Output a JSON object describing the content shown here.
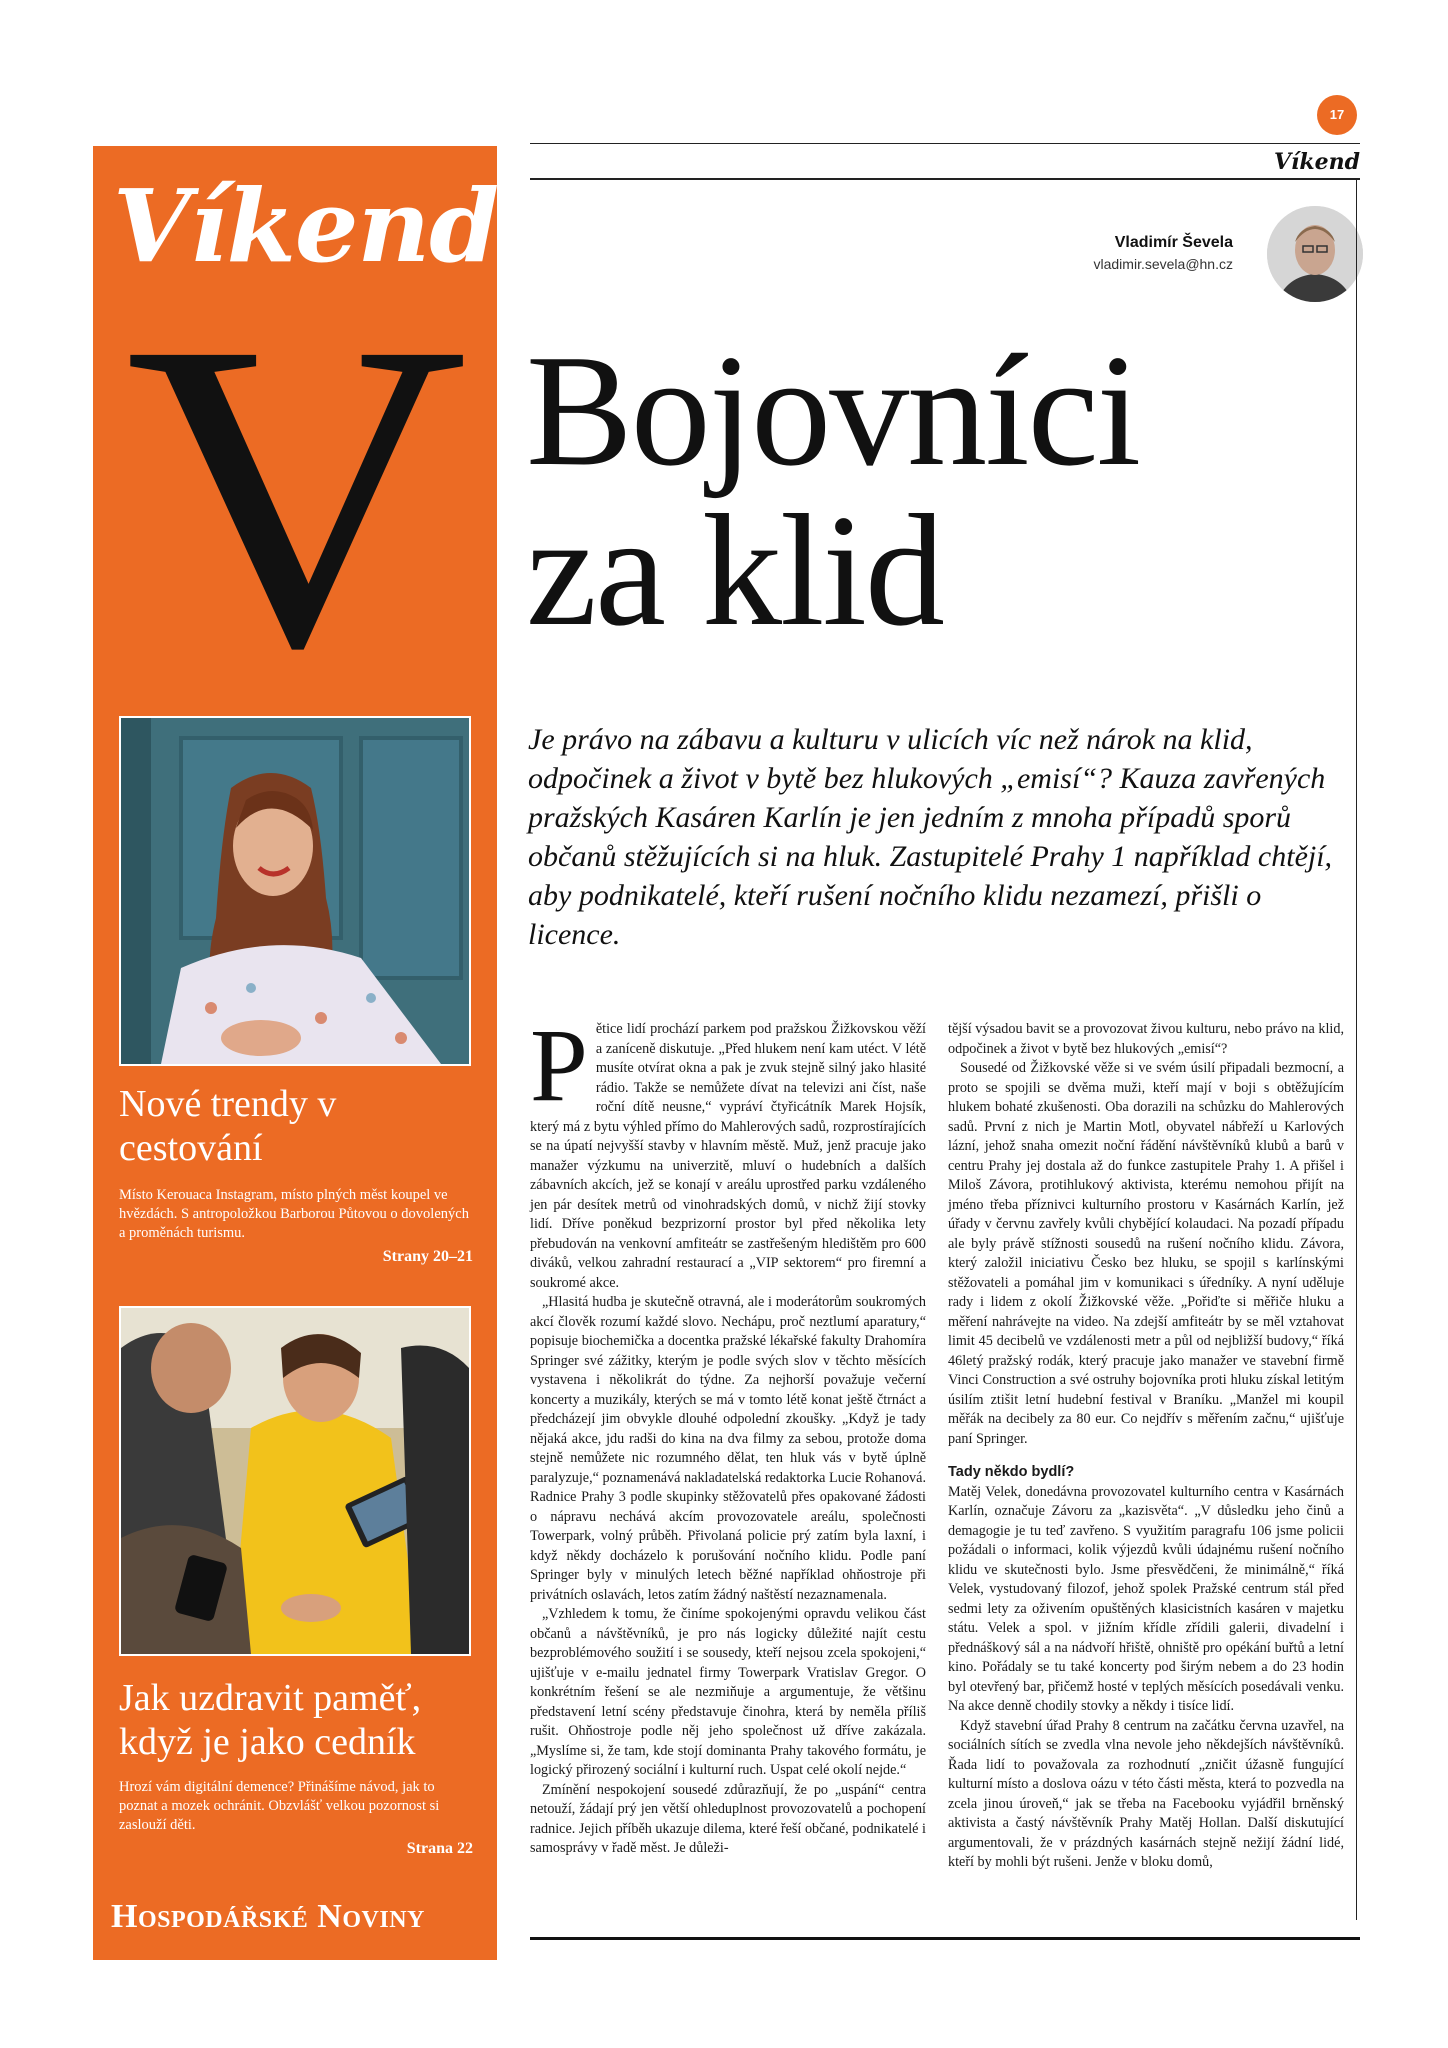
{
  "page": {
    "number": "17",
    "section": "Víkend"
  },
  "sidebar": {
    "title": "Víkend",
    "big_letter": "V",
    "teaser1": {
      "headline": "Nové trendy v cestování",
      "description": "Místo Kerouaca Instagram, místo plných měst koupel ve hvězdách. S antropoložkou Barborou Půtovou o dovolených a proměnách turismu.",
      "pages": "Strany 20–21"
    },
    "teaser2": {
      "headline": "Jak uzdravit paměť, když je jako cedník",
      "description": "Hrozí vám digitální demence? Přinášíme návod, jak to poznat a mozek ochránit. Obzvlášť velkou pozornost si zaslouží děti.",
      "pages": "Strana 22"
    },
    "logo": "Hospodářské Noviny"
  },
  "author": {
    "name": "Vladimír Ševela",
    "email": "vladimir.sevela@hn.cz"
  },
  "article": {
    "headline_line1": "Bojovníci",
    "headline_line2": "za klid",
    "lede": "Je právo na zábavu a kulturu v ulicích víc než nárok na klid, odpočinek a život v bytě bez hlukových „emisí“? Kauza zavřených pražských Kasáren Karlín je jen jedním z mnoha případů sporů občanů stěžujících si na hluk. Zastupitelé Prahy 1 například chtějí, aby podnikatelé, kteří rušení nočního klidu nezamezí, přišli o licence.",
    "dropcap": "P",
    "col1_p1": "ětice lidí prochází parkem pod pražskou Žižkovskou věží a zaníceně diskutuje. „Před hlukem není kam utéct. V létě musíte otvírat okna a pak je zvuk stejně silný jako hlasité rádio. Takže se nemůžete dívat na televizi ani číst, naše roční dítě neusne,“ vypráví čtyřicátník Marek Hojsík, který má z bytu výhled přímo do Mahlerových sadů, rozprostírajících se na úpatí nejvyšší stavby v hlavním městě. Muž, jenž pracuje jako manažer výzkumu na univerzitě, mluví o hudebních a dalších zábavních akcích, jež se konají v areálu uprostřed parku vzdáleného jen pár desítek metrů od vinohradských domů, v nichž žijí stovky lidí. Dříve poněkud bezprizorní prostor byl před několika lety přebudován na venkovní amfiteátr se zastřešeným hledištěm pro 600 diváků, velkou zahradní restaurací a „VIP sektorem“ pro firemní a soukromé akce.",
    "col1_p2": "„Hlasitá hudba je skutečně otravná, ale i moderátorům soukromých akcí člověk rozumí každé slovo. Nechápu, proč neztlumí aparatury,“ popisuje biochemička a docentka pražské lékařské fakulty Drahomíra Springer své zážitky, kterým je podle svých slov v těchto měsících vystavena i několikrát do týdne. Za nejhorší považuje večerní koncerty a muzikály, kterých se má v tomto létě konat ještě čtrnáct a předcházejí jim obvykle dlouhé odpolední zkoušky. „Když je tady nějaká akce, jdu radši do kina na dva filmy za sebou, protože doma stejně nemůžete nic rozumného dělat, ten hluk vás v bytě úplně paralyzuje,“ poznamenává nakladatelská redaktorka Lucie Rohanová. Radnice Prahy 3 podle skupinky stěžovatelů přes opakované žádosti o nápravu nechává akcím provozovatele areálu, společnosti Towerpark, volný průběh. Přivolaná policie prý zatím byla laxní, i když někdy docházelo k porušování nočního klidu. Podle paní Springer byly v minulých letech běžné například ohňostroje při privátních oslavách, letos zatím žádný naštěstí nezaznamenala.",
    "col1_p3": "„Vzhledem k tomu, že činíme spokojenými opravdu velikou část občanů a návštěvníků, je pro nás logicky důležité najít cestu bezproblémového soužití i se sousedy, kteří nejsou zcela spokojeni,“ ujišťuje v e-mailu jednatel firmy Towerpark Vratislav Gregor. O konkrétním řešení se ale nezmiňuje a argumentuje, že většinu představení letní scény představuje činohra, která by neměla příliš rušit. Ohňostroje podle něj jeho společnost už dříve zakázala. „Myslíme si, že tam, kde stojí dominanta Prahy takového formátu, je logický přirozený sociální i kulturní ruch. Uspat celé okolí nejde.“",
    "col1_p4": "Zmínění nespokojení sousedé zdůrazňují, že po „uspání“ centra netouží, žádají prý jen větší ohleduplnost provozovatelů a pochopení radnice. Jejich příběh ukazuje dilema, které řeší občané, podnikatelé i samosprávy v řadě měst. Je důleži-",
    "col2_p1": "tější výsadou bavit se a provozovat živou kulturu, nebo právo na klid, odpočinek a život v bytě bez hlukových „emisí“?",
    "col2_p2": "Sousedé od Žižkovské věže si ve svém úsilí připadali bezmocní, a proto se spojili se dvěma muži, kteří mají v boji s obtěžujícím hlukem bohaté zkušenosti. Oba dorazili na schůzku do Mahlerových sadů. První z nich je Martin Motl, obyvatel nábřeží u Karlových lázní, jehož snaha omezit noční řádění návštěvníků klubů a barů v centru Prahy jej dostala až do funkce zastupitele Prahy 1. A přišel i Miloš Závora, protihlukový aktivista, kterému nemohou přijít na jméno třeba příznivci kulturního prostoru v Kasárnách Karlín, jež úřady v červnu zavřely kvůli chybějící kolaudaci. Na pozadí případu ale byly právě stížnosti sousedů na rušení nočního klidu. Závora, který založil iniciativu Česko bez hluku, se spojil s karlínskými stěžovateli a pomáhal jim v komunikaci s úředníky. A nyní uděluje rady i lidem z okolí Žižkovské věže. „Pořiďte si měřiče hluku a měření nahrávejte na video. Na zdejší amfiteátr by se měl vztahovat limit 45 decibelů ve vzdálenosti metr a půl od nejbližší budovy,“ říká 46letý pražský rodák, který pracuje jako manažer ve stavební firmě Vinci Construction a své ostruhy bojovníka proti hluku získal letitým úsilím ztišit letní hudební festival v Braníku. „Manžel mi koupil měřák na decibely za 80 eur. Co nejdřív s měřením začnu,“ ujišťuje paní Springer.",
    "subhead": "Tady někdo bydlí?",
    "col2_p3": "Matěj Velek, donedávna provozovatel kulturního centra v Kasárnách Karlín, označuje Závoru za „kazisvěta“. „V důsledku jeho činů a demagogie je tu teď zavřeno. S využitím paragrafu 106 jsme policii požádali o informaci, kolik výjezdů kvůli údajnému rušení nočního klidu ve skutečnosti bylo. Jsme přesvědčeni, že minimálně,“ říká Velek, vystudovaný filozof, jehož spolek Pražské centrum stál před sedmi lety za oživením opuštěných klasicistních kasáren v majetku státu. Velek a spol. v jižním křídle zřídili galerii, divadelní i přednáškový sál a na nádvoří hřiště, ohniště pro opékání buřtů a letní kino. Pořádaly se tu také koncerty pod širým nebem a do 23 hodin byl otevřený bar, přičemž hosté v teplých měsících posedávali venku. Na akce denně chodily stovky a někdy i tisíce lidí.",
    "col2_p4": "Když stavební úřad Prahy 8 centrum na začátku června uzavřel, na sociálních sítích se zvedla vlna nevole jeho někdejších návštěvníků. Řada lidí to považovala za rozhodnutí „zničit úžasně fungující kulturní místo a doslova oázu v této části města, která to pozvedla na zcela jinou úroveň,“ jak se třeba na Facebooku vyjádřil brněnský aktivista a častý návštěvník Prahy Matěj Hollan. Další diskutující argumentovali, že v prázdných kasárnách stejně nežijí žádní lidé, kteří by mohli být rušeni. Jenže v bloku domů,"
  }
}
